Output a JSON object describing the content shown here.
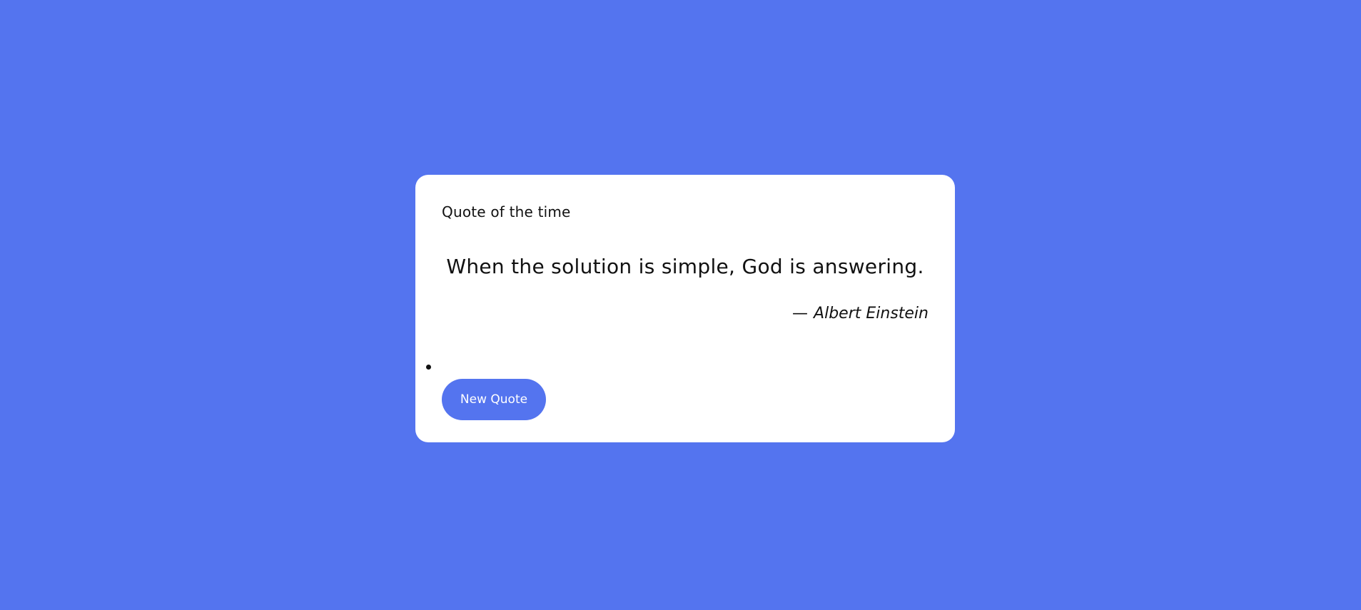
{
  "card": {
    "title": "Quote of the time",
    "quote": "When the solution is simple, God is answering.",
    "author_dash": "—",
    "author": "Albert Einstein",
    "button_label": "New Quote"
  },
  "colors": {
    "background": "#5474ef",
    "card": "#ffffff",
    "button": "#5474ef",
    "text": "#111111",
    "button_text": "#ffffff"
  }
}
